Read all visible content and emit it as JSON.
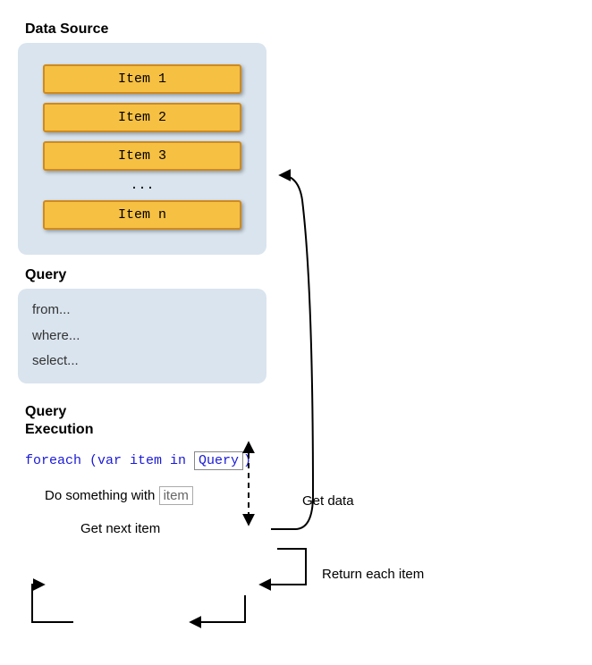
{
  "dataSource": {
    "title": "Data Source",
    "items": [
      "Item 1",
      "Item 2",
      "Item 3"
    ],
    "ellipsis": "...",
    "lastItem": "Item n"
  },
  "query": {
    "title": "Query",
    "lines": [
      "from...",
      "where...",
      "select..."
    ]
  },
  "execution": {
    "title1": "Query",
    "title2": "Execution",
    "foreach_prefix": "foreach (var item in ",
    "queryBox": "Query",
    "foreach_suffix": ")",
    "doLine_prefix": "Do something with ",
    "itemBox": "item",
    "getNext": "Get next item"
  },
  "labels": {
    "getData": "Get data",
    "returnEach": "Return each item"
  }
}
